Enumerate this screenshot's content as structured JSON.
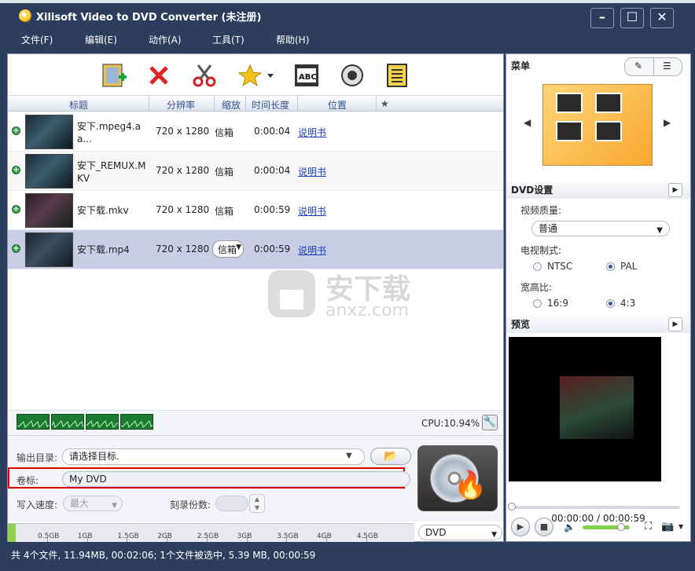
{
  "window": {
    "title": "Xilisoft Video to DVD Converter (未注册)"
  },
  "menubar": [
    "文件(F)",
    "编辑(E)",
    "动作(A)",
    "工具(T)",
    "帮助(H)"
  ],
  "toolbar": [
    "add-video-icon",
    "delete-icon",
    "cut-icon",
    "effects-icon",
    "subtitle-icon",
    "audio-icon",
    "menu-icon"
  ],
  "columns": {
    "title": "标题",
    "resolution": "分辨率",
    "zoom": "缩放",
    "duration": "时间长度",
    "position": "位置",
    "star": "★"
  },
  "rows": [
    {
      "name": "安下.mpeg4.aa...",
      "resolution": "720 x 1280",
      "zoom": "信箱",
      "duration": "0:00:04",
      "position": "说明书"
    },
    {
      "name": "安下_REMUX.MKV",
      "resolution": "720 x 1280",
      "zoom": "信箱",
      "duration": "0:00:04",
      "position": "说明书"
    },
    {
      "name": "安下载.mkv",
      "resolution": "720 x 1280",
      "zoom": "信箱",
      "duration": "0:00:59",
      "position": "说明书"
    },
    {
      "name": "安下载.mp4",
      "resolution": "720 x 1280",
      "zoom": "信箱",
      "duration": "0:00:59",
      "position": "说明书"
    }
  ],
  "watermark": {
    "text": "安下载",
    "sub": "anxz.com"
  },
  "cpu": "CPU:10.94%",
  "output": {
    "dir_label": "输出目录:",
    "dir_value": "请选择目标.",
    "vol_label": "卷标:",
    "vol_value": "My DVD",
    "speed_label": "写入速度:",
    "speed_value": "最大",
    "copies_label": "刻录份数:"
  },
  "capacity": {
    "ticks": [
      "0.5GB",
      "1GB",
      "1.5GB",
      "2GB",
      "2.5GB",
      "3GB",
      "3.5GB",
      "4GB",
      "4.5GB"
    ],
    "used_fraction": 0.02,
    "disc": "DVD"
  },
  "right": {
    "menu_title": "菜单",
    "dvd_settings": "DVD设置",
    "quality_label": "视频质量:",
    "quality_value": "普通",
    "tv_label": "电视制式:",
    "ntsc": "NTSC",
    "pal": "PAL",
    "aspect_label": "宽高比:",
    "a169": "16:9",
    "a43": "4:3",
    "preview_title": "预览",
    "timecode": "00:00:00 / 00:00:59"
  },
  "status": "共 4个文件, 11.94MB, 00:02:06; 1个文件被选中, 5.39 MB, 00:00:59"
}
